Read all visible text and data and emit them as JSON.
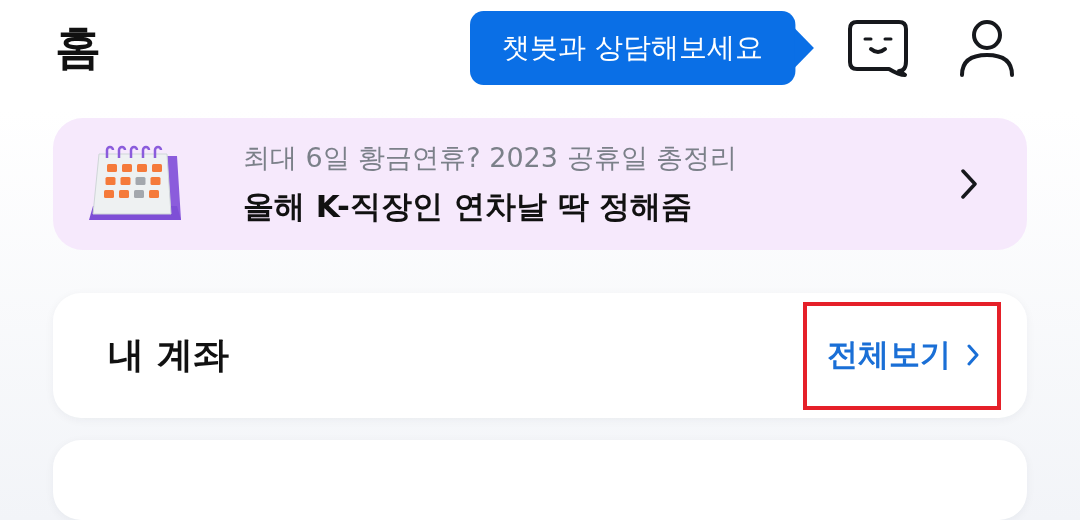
{
  "header": {
    "title": "홈",
    "chatbot_tip": "챗봇과 상담해보세요"
  },
  "banner": {
    "subtitle": "최대 6일 황금연휴? 2023 공휴일 총정리",
    "title": "올해 K-직장인 연차날 딱 정해줌"
  },
  "my_accounts": {
    "title": "내 계좌",
    "view_all": {
      "label": "전체보기",
      "highlighted": true
    }
  }
}
